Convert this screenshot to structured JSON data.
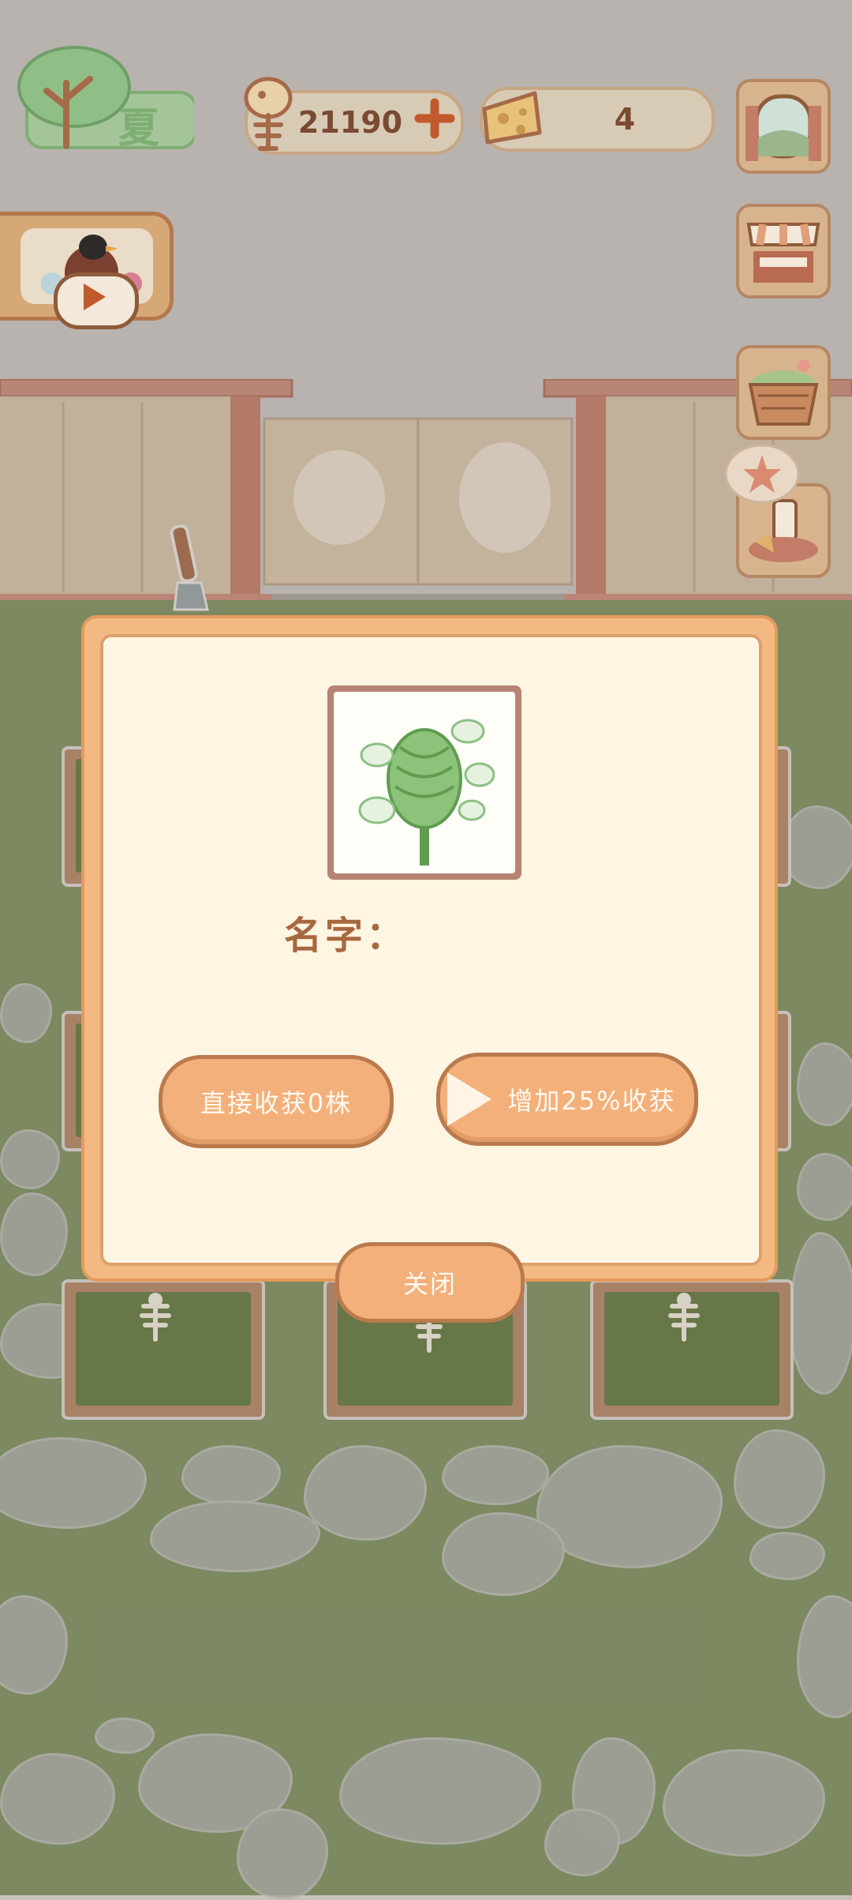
{
  "hud": {
    "season": "夏",
    "fish_count": "21190",
    "cheese_count": "4"
  },
  "dialog": {
    "name_label": "名字：",
    "harvest_button": "直接收获0株",
    "boost_button": "增加25%收获",
    "close_button": "关闭"
  },
  "colors": {
    "accent": "#f4b07a",
    "accent_border": "#b97a4c",
    "panel_bg": "#fff5e3",
    "label_text": "#a8683f",
    "grass": "#7f8f5f"
  },
  "icons": {
    "fish": "fish-bone-icon",
    "plus": "plus-icon",
    "cheese": "cheese-icon",
    "window": "window-icon",
    "shop": "shop-stall-icon",
    "basket": "basket-icon",
    "snack": "snack-tray-icon",
    "play": "play-icon"
  }
}
